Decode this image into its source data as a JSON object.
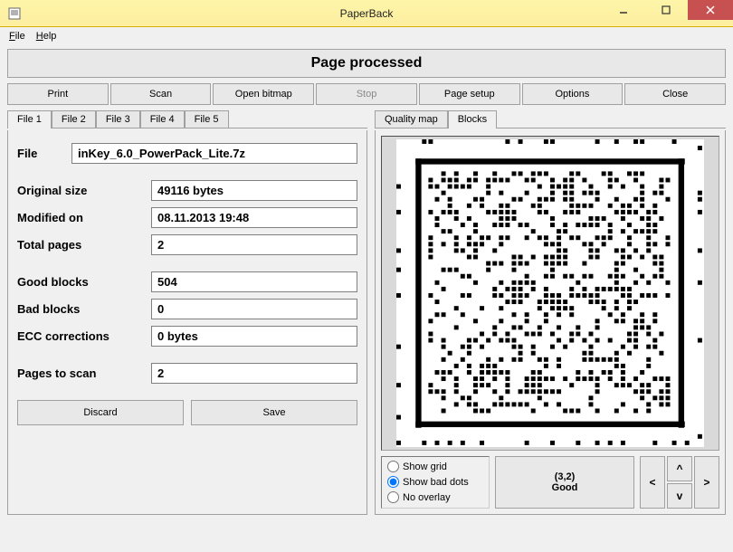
{
  "window": {
    "title": "PaperBack"
  },
  "menu": {
    "file": "File",
    "help": "Help"
  },
  "status": "Page processed",
  "toolbar": {
    "print": "Print",
    "scan": "Scan",
    "open_bitmap": "Open bitmap",
    "stop": "Stop",
    "page_setup": "Page setup",
    "options": "Options",
    "close": "Close"
  },
  "file_tabs": [
    "File 1",
    "File 2",
    "File 3",
    "File 4",
    "File 5"
  ],
  "form": {
    "file_label": "File",
    "file_value": "inKey_6.0_PowerPack_Lite.7z",
    "original_size_label": "Original size",
    "original_size_value": "49116 bytes",
    "modified_on_label": "Modified on",
    "modified_on_value": "08.11.2013 19:48",
    "total_pages_label": "Total pages",
    "total_pages_value": "2",
    "good_blocks_label": "Good blocks",
    "good_blocks_value": "504",
    "bad_blocks_label": "Bad blocks",
    "bad_blocks_value": "0",
    "ecc_corrections_label": "ECC corrections",
    "ecc_corrections_value": "0 bytes",
    "pages_to_scan_label": "Pages to scan",
    "pages_to_scan_value": "2"
  },
  "actions": {
    "discard": "Discard",
    "save": "Save"
  },
  "right_tabs": {
    "quality_map": "Quality map",
    "blocks": "Blocks"
  },
  "overlay": {
    "show_grid": "Show grid",
    "show_bad_dots": "Show bad dots",
    "no_overlay": "No overlay",
    "selected": "show_bad_dots"
  },
  "block_info": {
    "coord": "(3,2)",
    "status": "Good"
  },
  "nav": {
    "up": "^",
    "down": "v",
    "left": "<",
    "right": ">"
  }
}
